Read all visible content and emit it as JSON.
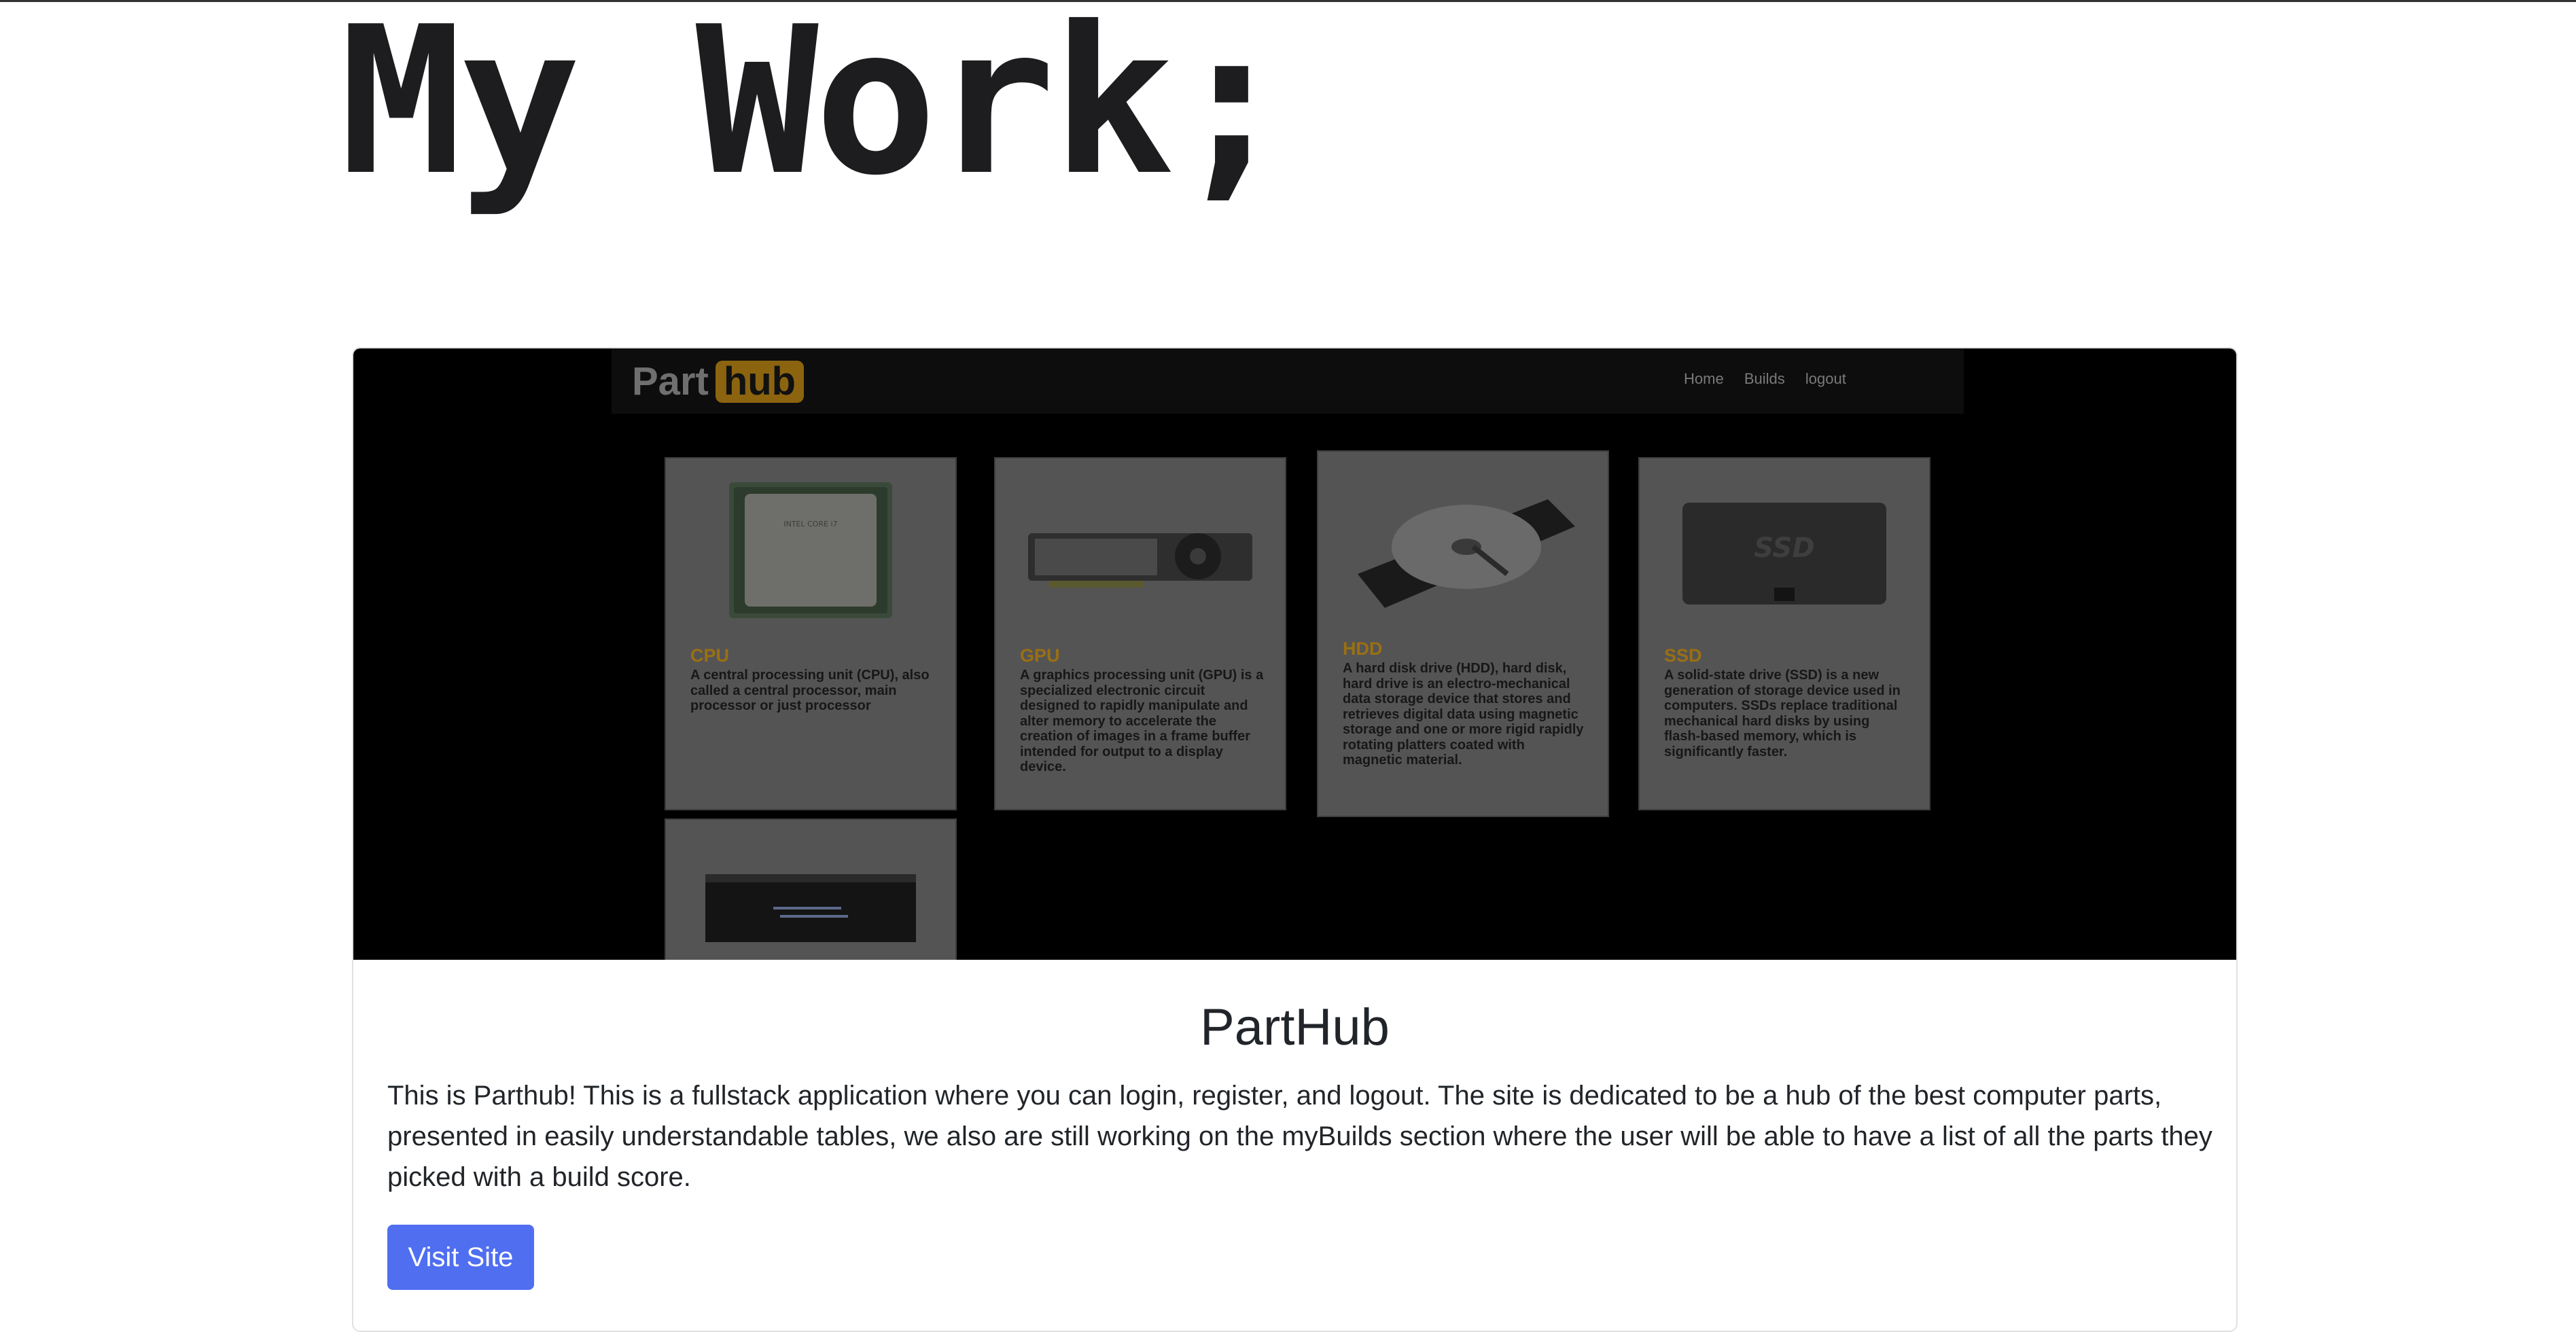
{
  "page": {
    "heading": "My Work;"
  },
  "project": {
    "title": "PartHub",
    "description": "This is Parthub! This is a fullstack application where you can login, register, and logout. The site is dedicated to be a hub of the best computer parts, presented in easily understandable tables, we also are still working on the myBuilds section where the user will be able to have a list of all the parts they picked with a build score.",
    "button_label": "Visit Site"
  },
  "screenshot": {
    "logo_part": "Part",
    "logo_hub": "hub",
    "nav_links": [
      "Home",
      "Builds",
      "logout"
    ],
    "parts": [
      {
        "title": "CPU",
        "desc": "A central processing unit (CPU), also called a central processor, main processor or just processor",
        "icon": "cpu-icon"
      },
      {
        "title": "GPU",
        "desc": "A graphics processing unit (GPU) is a specialized electronic circuit designed to rapidly manipulate and alter memory to accelerate the creation of images in a frame buffer intended for output to a display device.",
        "icon": "gpu-icon"
      },
      {
        "title": "HDD",
        "desc": "A hard disk drive (HDD), hard disk, hard drive is an electro-mechanical data storage device that stores and retrieves digital data using magnetic storage and one or more rigid rapidly rotating platters coated with magnetic material.",
        "icon": "hdd-icon"
      },
      {
        "title": "SSD",
        "desc": "A solid-state drive (SSD) is a new generation of storage device used in computers. SSDs replace traditional mechanical hard disks by using flash-based memory, which is significantly faster.",
        "icon": "ssd-icon"
      }
    ],
    "ssd_label": "SSD",
    "cpu_chip_text": "INTEL CORE i7",
    "accent": "#9a6f14",
    "button_color": "#4f6ef0"
  }
}
